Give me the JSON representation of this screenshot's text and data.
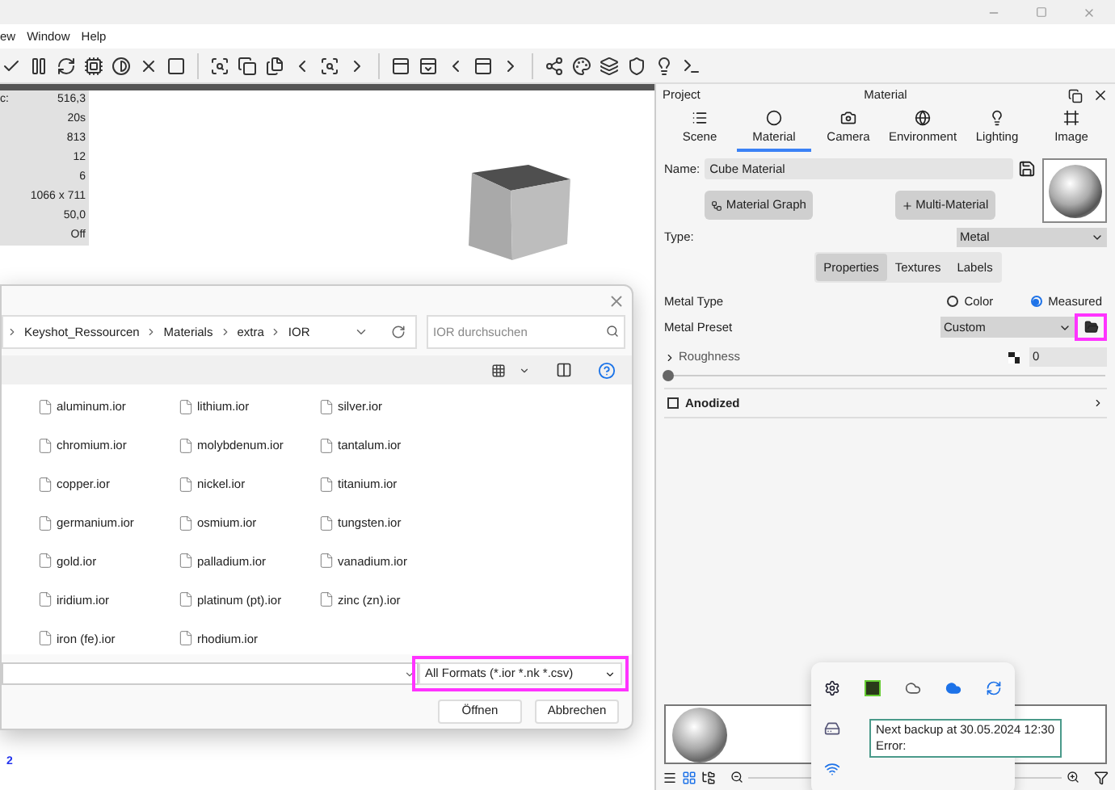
{
  "menu": [
    "ew",
    "Window",
    "Help"
  ],
  "stats": [
    {
      "label": "c:",
      "value": "516,3"
    },
    {
      "value": "20s"
    },
    {
      "value": "813"
    },
    {
      "value": "12"
    },
    {
      "value": "6"
    },
    {
      "value": "1066 x 711"
    },
    {
      "value": "50,0"
    },
    {
      "value": "Off"
    }
  ],
  "file_dialog": {
    "breadcrumb": [
      "Keyshot_Ressourcen",
      "Materials",
      "extra",
      "IOR"
    ],
    "search": {
      "placeholder": "IOR durchsuchen"
    },
    "files": [
      "aluminum.ior",
      "chromium.ior",
      "copper.ior",
      "germanium.ior",
      "gold.ior",
      "iridium.ior",
      "iron (fe).ior",
      "lithium.ior",
      "molybdenum.ior",
      "nickel.ior",
      "osmium.ior",
      "palladium.ior",
      "platinum (pt).ior",
      "rhodium.ior",
      "silver.ior",
      "tantalum.ior",
      "titanium.ior",
      "tungsten.ior",
      "vanadium.ior",
      "zinc (zn).ior"
    ],
    "file_type": "All Formats (*.ior *.nk *.csv)",
    "buttons": [
      "Öffnen",
      "Abbrechen"
    ]
  },
  "below_dialog_text": "2",
  "panel": {
    "header": {
      "left": "Project",
      "title": "Material"
    },
    "tabs": [
      {
        "label": "Scene",
        "selected": false
      },
      {
        "label": "Material",
        "selected": true
      },
      {
        "label": "Camera",
        "selected": false
      },
      {
        "label": "Environment",
        "selected": false
      },
      {
        "label": "Lighting",
        "selected": false
      },
      {
        "label": "Image",
        "selected": false
      }
    ],
    "name": {
      "label": "Name:",
      "value": "Cube Material"
    },
    "buttons": [
      "Material Graph",
      "Multi-Material"
    ],
    "type": {
      "label": "Type:",
      "value": "Metal"
    },
    "subtabs": [
      {
        "label": "Properties",
        "selected": true
      },
      {
        "label": "Textures",
        "selected": false
      },
      {
        "label": "Labels",
        "selected": false
      }
    ],
    "metal_type": {
      "label": "Metal Type",
      "options": [
        {
          "label": "Color",
          "selected": false
        },
        {
          "label": "Measured",
          "selected": true
        }
      ]
    },
    "metal_preset": {
      "label": "Metal Preset",
      "value": "Custom"
    },
    "roughness": {
      "label": "Roughness",
      "value": "0",
      "level": 0,
      "expanded": false
    },
    "anodized": {
      "label": "Anodized",
      "checked": false
    }
  },
  "tray_tooltip": [
    "Next backup at 30.05.2024 12:30",
    "Error:"
  ]
}
